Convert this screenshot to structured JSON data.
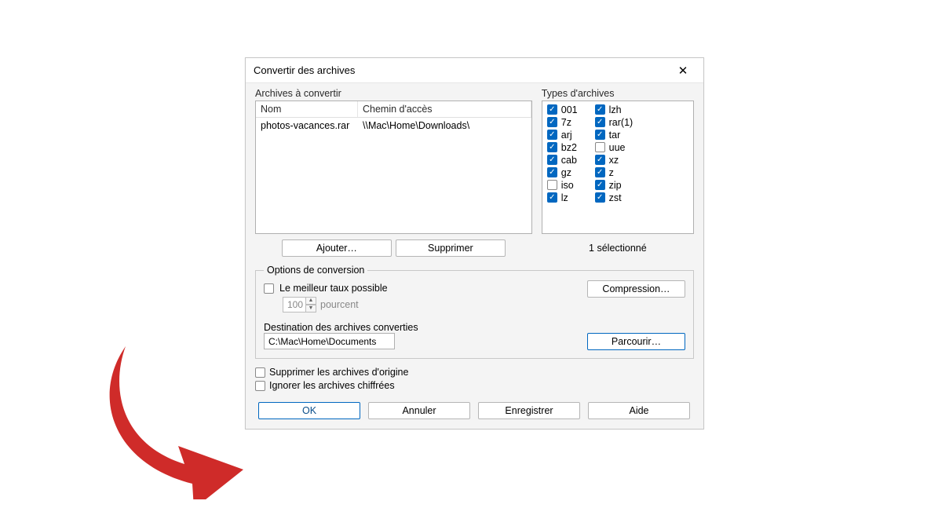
{
  "titlebar": {
    "title": "Convertir des archives"
  },
  "archives": {
    "label": "Archives à convertir",
    "headers": {
      "name": "Nom",
      "path": "Chemin d'accès"
    },
    "rows": [
      {
        "name": "photos-vacances.rar",
        "path": "\\\\Mac\\Home\\Downloads\\"
      }
    ],
    "add_btn": "Ajouter…",
    "remove_btn": "Supprimer"
  },
  "types": {
    "label": "Types d'archives",
    "col1": [
      {
        "label": "001",
        "checked": true
      },
      {
        "label": "7z",
        "checked": true
      },
      {
        "label": "arj",
        "checked": true
      },
      {
        "label": "bz2",
        "checked": true
      },
      {
        "label": "cab",
        "checked": true
      },
      {
        "label": "gz",
        "checked": true
      },
      {
        "label": "iso",
        "checked": false
      },
      {
        "label": "lz",
        "checked": true
      }
    ],
    "col2": [
      {
        "label": "lzh",
        "checked": true
      },
      {
        "label": "rar(1)",
        "checked": true
      },
      {
        "label": "tar",
        "checked": true
      },
      {
        "label": "uue",
        "checked": false
      },
      {
        "label": "xz",
        "checked": true
      },
      {
        "label": "z",
        "checked": true
      },
      {
        "label": "zip",
        "checked": true
      },
      {
        "label": "zst",
        "checked": true
      }
    ],
    "selection_count": "1 sélectionné"
  },
  "options": {
    "legend": "Options de conversion",
    "best_rate": {
      "label": "Le meilleur taux possible",
      "checked": false
    },
    "percent": {
      "value": "100",
      "unit": "pourcent"
    },
    "compression_btn": "Compression…",
    "dest_label": "Destination des archives converties",
    "dest_value": "C:\\Mac\\Home\\Documents",
    "browse_btn": "Parcourir…",
    "delete_original": {
      "label": "Supprimer les archives d'origine",
      "checked": false
    },
    "ignore_encrypted": {
      "label": "Ignorer les archives chiffrées",
      "checked": false
    }
  },
  "buttons": {
    "ok": "OK",
    "cancel": "Annuler",
    "save": "Enregistrer",
    "help": "Aide"
  }
}
